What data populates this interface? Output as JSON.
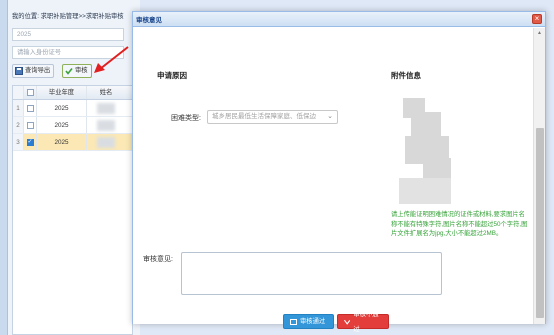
{
  "background": {
    "breadcrumb": "我的位置: 求职补贴管理>>求职补贴审核",
    "year_input_value": "2025",
    "id_input_placeholder": "请输入身份证号",
    "toolbar": {
      "query_export_label": "查询导出",
      "review_label": "审核"
    },
    "grid": {
      "columns": [
        "毕业年度",
        "姓名"
      ],
      "rows": [
        {
          "index": "1",
          "year": "2025",
          "checked": false
        },
        {
          "index": "2",
          "year": "2025",
          "checked": false
        },
        {
          "index": "3",
          "year": "2025",
          "checked": true
        }
      ]
    }
  },
  "modal": {
    "title": "审核意见",
    "application_reason_heading": "申请原因",
    "attachment_heading": "附件信息",
    "difficulty_type_label": "困难类型:",
    "difficulty_type_value": "城乡居民最低生活保障家庭、低保边",
    "notice": "请上传能证明困难情况的证件或材料,要求图片名称不能有特殊字符,图片名称不能超过50个字符,图片文件扩展名为jpg,大小不能超过2MB。",
    "review_opinion_label": "审核意见:",
    "review_opinion_value": "",
    "approve_button": "审核通过",
    "reject_button": "审核不通过"
  },
  "colors": {
    "header_bg": "#cddff3",
    "approve": "#3296d8",
    "reject": "#e33e3b",
    "notice_text": "#37a33a",
    "selected_row": "#fbe8b5"
  }
}
